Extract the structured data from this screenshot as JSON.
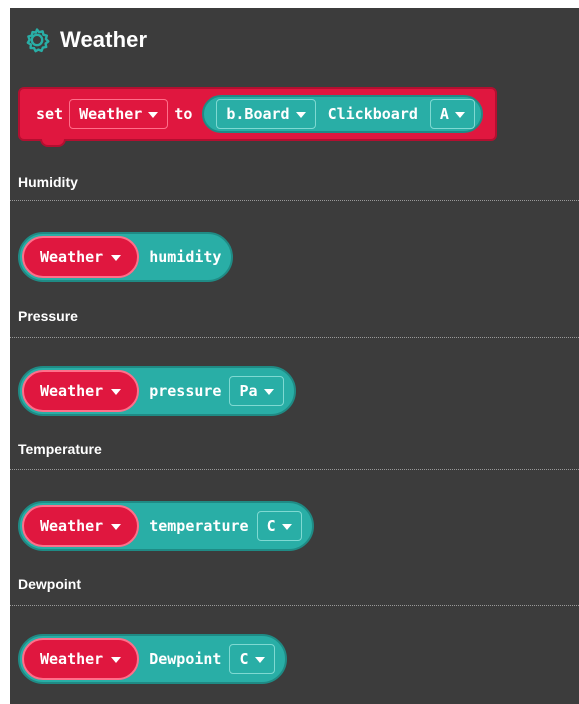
{
  "header": {
    "title": "Weather",
    "icon": "gear-icon",
    "icon_color": "#29aea6"
  },
  "colors": {
    "panel_bg": "#3c3c3c",
    "block_red": "#e0173f",
    "block_teal": "#29aea6"
  },
  "set_block": {
    "keyword_set": "set",
    "variable": "Weather",
    "keyword_to": "to",
    "board": "b.Board",
    "label": "Clickboard",
    "slot": "A"
  },
  "sections": [
    {
      "label": "Humidity",
      "block": {
        "variable": "Weather",
        "field": "humidity",
        "unit": null
      }
    },
    {
      "label": "Pressure",
      "block": {
        "variable": "Weather",
        "field": "pressure",
        "unit": "Pa"
      }
    },
    {
      "label": "Temperature",
      "block": {
        "variable": "Weather",
        "field": "temperature",
        "unit": "C"
      }
    },
    {
      "label": "Dewpoint",
      "block": {
        "variable": "Weather",
        "field": "Dewpoint",
        "unit": "C"
      }
    }
  ]
}
